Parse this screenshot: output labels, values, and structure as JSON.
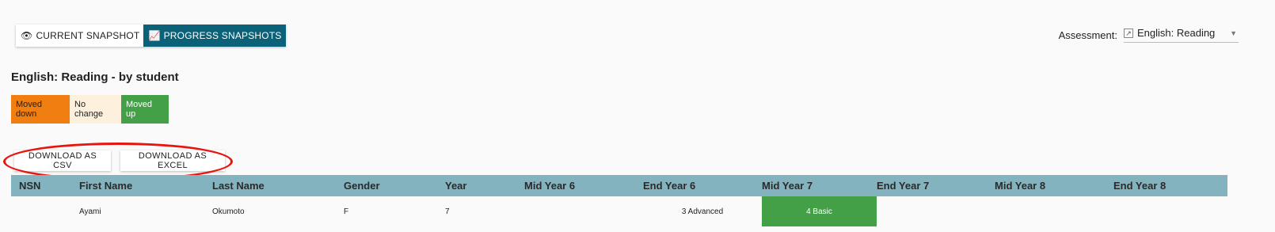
{
  "tabs": [
    {
      "label": "CURRENT SNAPSHOT",
      "icon": "eye-icon"
    },
    {
      "label": "PROGRESS SNAPSHOTS",
      "icon": "chart-icon"
    }
  ],
  "assessment": {
    "label": "Assessment:",
    "value": "English: Reading"
  },
  "heading": "English: Reading - by student",
  "legend": {
    "moved_down": "Moved down",
    "no_change": "No change",
    "moved_up": "Moved up"
  },
  "colors": {
    "moved_down": "#f07e10",
    "no_change": "#fdf1dd",
    "moved_up": "#43a047",
    "header": "#82b3bf",
    "accent": "#0b6178",
    "highlight": "#e8150f"
  },
  "downloads": {
    "csv_label": "DOWNLOAD AS CSV",
    "excel_label": "DOWNLOAD AS EXCEL"
  },
  "table": {
    "columns": [
      "NSN",
      "First Name",
      "Last Name",
      "Gender",
      "Year",
      "Mid Year 6",
      "End Year 6",
      "Mid Year 7",
      "End Year 7",
      "Mid Year 8",
      "End Year 8"
    ],
    "rows": [
      {
        "nsn": "",
        "first": "Ayami",
        "last": "Okumoto",
        "gender": "F",
        "year": "7",
        "mid6": "",
        "end6": "3 Advanced",
        "mid7": "4 Basic",
        "end7": "",
        "mid8": "",
        "end8": ""
      }
    ]
  }
}
